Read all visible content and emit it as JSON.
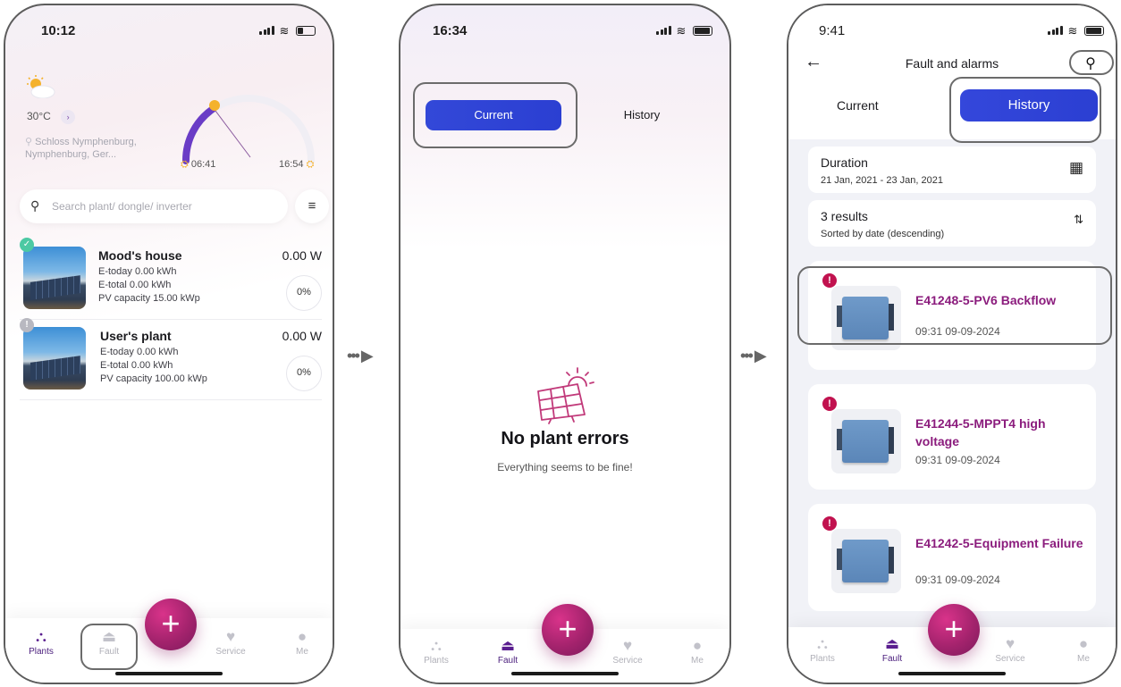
{
  "screen1": {
    "time": "10:12",
    "temperature": "30°C",
    "location": "Schloss Nymphenburg, Nymphenburg, Ger...",
    "sunrise": "06:41",
    "sunset": "16:54",
    "search_placeholder": "Search plant/ dongle/ inverter",
    "plants": [
      {
        "name": "Mood's house",
        "e_today": "E-today 0.00 kWh",
        "e_total": "E-total 0.00 kWh",
        "capacity": "PV capacity 15.00 kWp",
        "power": "0.00 W",
        "pct": "0%",
        "status": "ok"
      },
      {
        "name": "User's plant",
        "e_today": "E-today 0.00 kWh",
        "e_total": "E-total 0.00 kWh",
        "capacity": "PV capacity 100.00 kWp",
        "power": "0.00 W",
        "pct": "0%",
        "status": "offline"
      }
    ]
  },
  "screen2": {
    "time": "16:34",
    "tab_current": "Current",
    "tab_history": "History",
    "empty_title": "No plant errors",
    "empty_subtitle": "Everything seems to be fine!"
  },
  "screen3": {
    "time": "9:41",
    "title": "Fault and alarms",
    "tab_current": "Current",
    "tab_history": "History",
    "duration_label": "Duration",
    "duration_value": "21 Jan, 2021 - 23 Jan, 2021",
    "results_label": "3 results",
    "results_sort": "Sorted by date (descending)",
    "faults": [
      {
        "title": "E41248-5-PV6 Backflow",
        "time": "09:31 09-09-2024"
      },
      {
        "title": "E41244-5-MPPT4 high voltage",
        "time": "09:31 09-09-2024"
      },
      {
        "title": "E41242-5-Equipment Failure",
        "time": "09:31 09-09-2024"
      }
    ]
  },
  "nav": {
    "plants": "Plants",
    "fault": "Fault",
    "service": "Service",
    "me": "Me",
    "fab": "+"
  },
  "colors": {
    "accent_blue": "#2f43d6",
    "brand_magenta": "#a4236d",
    "fault_title": "#8b1c7d",
    "alert_red": "#c1124f"
  }
}
